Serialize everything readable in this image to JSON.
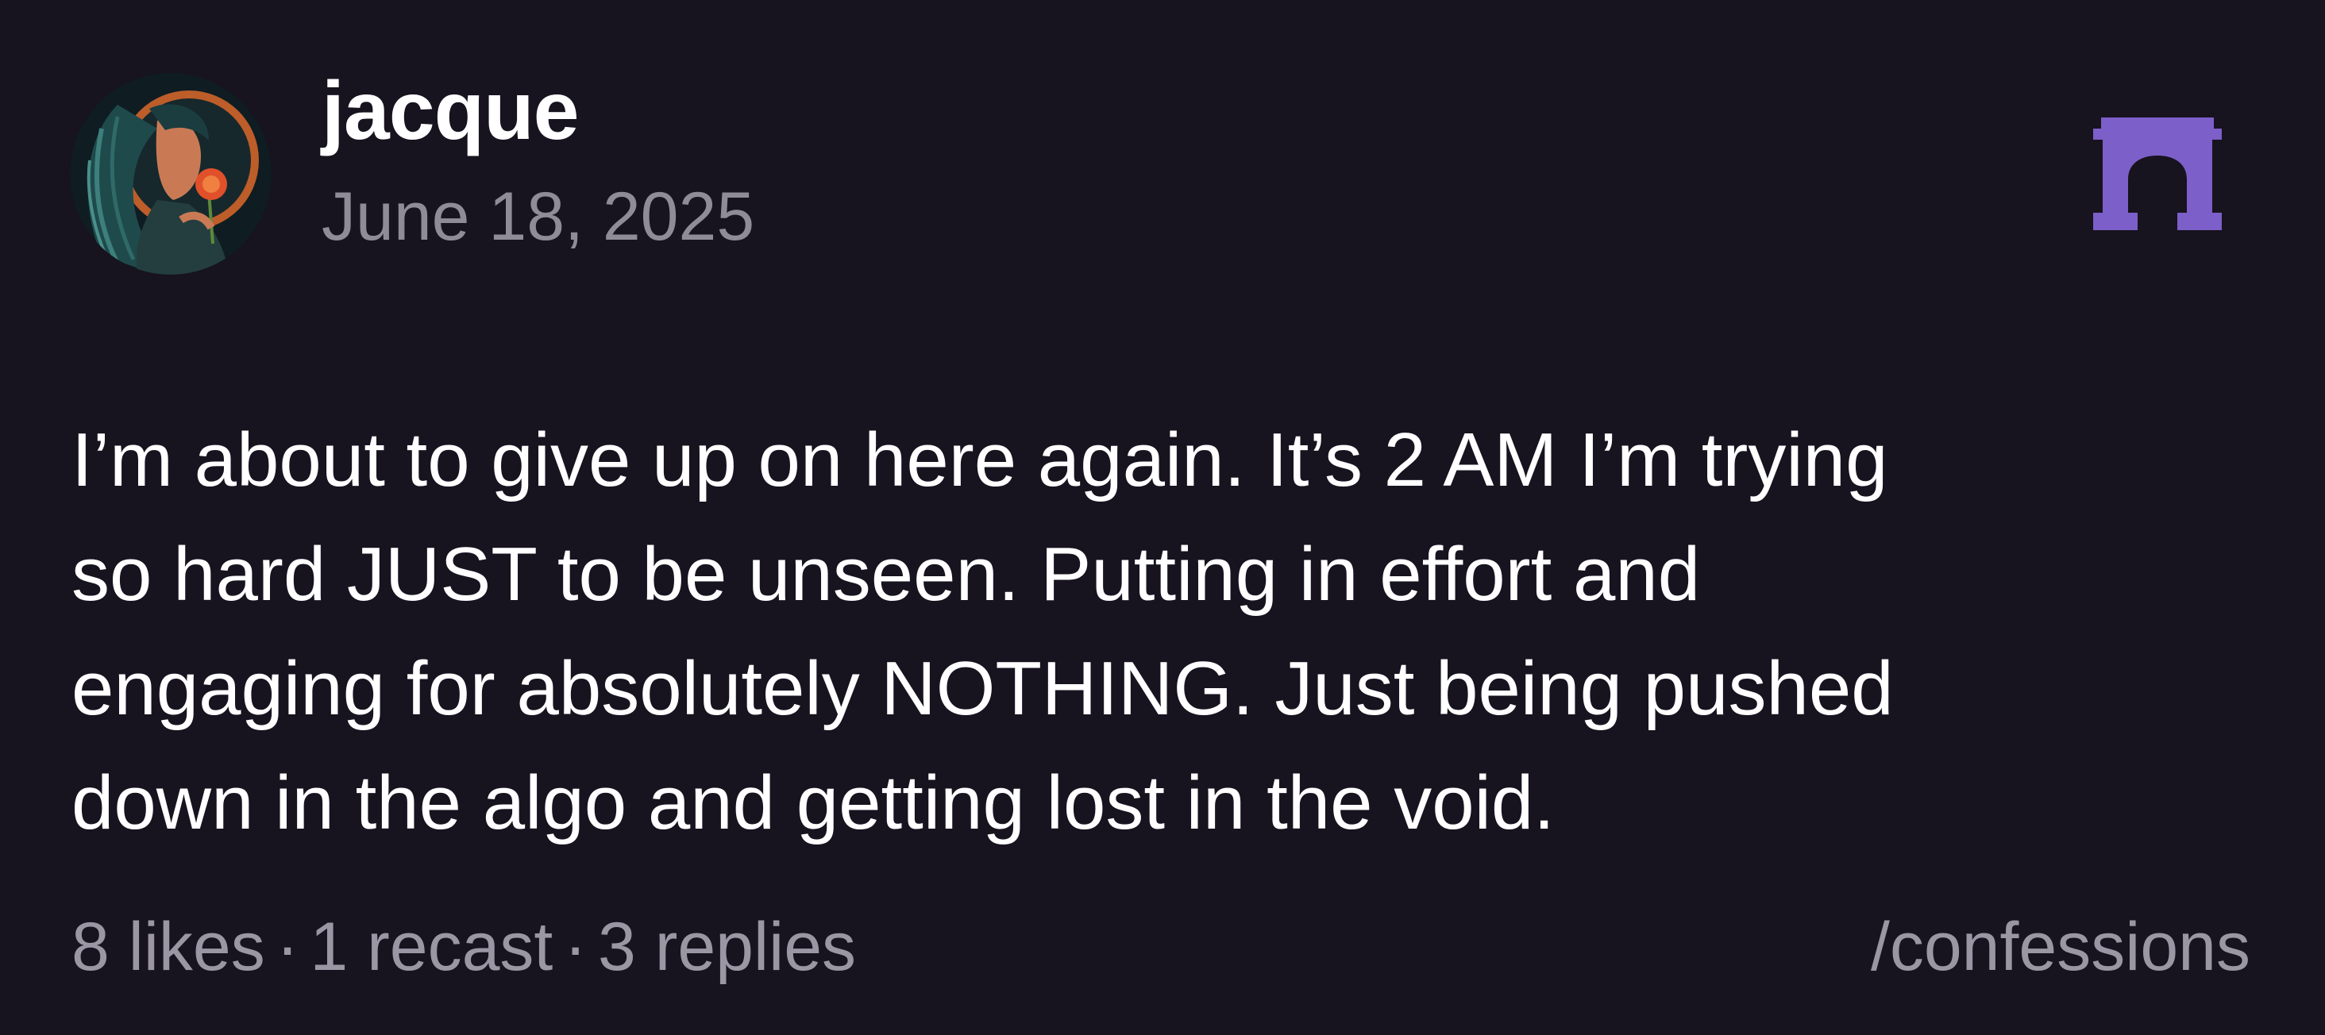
{
  "author": {
    "username": "jacque",
    "date": "June 18, 2025",
    "avatar_icon": "avatar-woman-with-rose-icon"
  },
  "channel": {
    "logo_icon": "farcaster-arch-icon",
    "logo_color": "#7c5fc8",
    "name": "/confessions"
  },
  "post": {
    "text": "I’m about to give up on here again. It’s 2 AM I’m trying\nso hard JUST to be unseen. Putting in effort and\nengaging for absolutely NOTHING. Just being pushed\ndown in the algo and getting lost in the void."
  },
  "stats": {
    "likes": "8 likes",
    "recasts": "1 recast",
    "replies": "3 replies",
    "separator": "·"
  },
  "colors": {
    "background": "#17131f",
    "text": "#ffffff",
    "muted": "#8f8b97"
  }
}
